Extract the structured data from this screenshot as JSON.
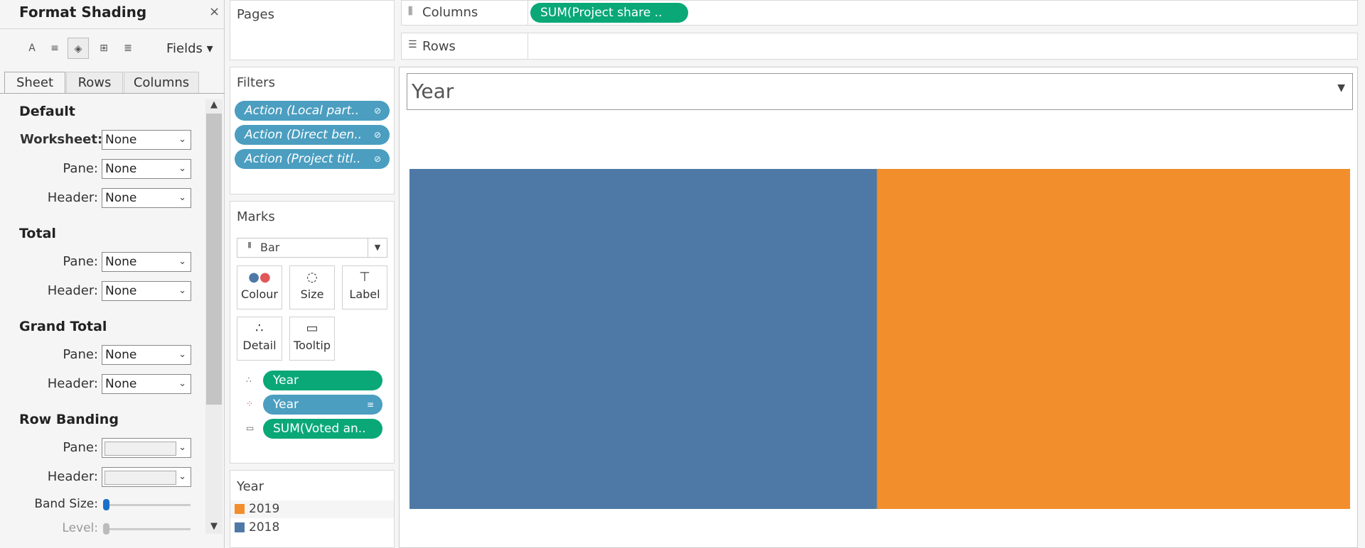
{
  "format_pane": {
    "title": "Format Shading",
    "close": "×",
    "toolbar": {
      "font": "A",
      "align": "≡",
      "shading": "◈",
      "borders": "⊞",
      "lines": "≣"
    },
    "fields_label": "Fields ▾",
    "tabs": [
      "Sheet",
      "Rows",
      "Columns"
    ],
    "sections": {
      "default": {
        "title": "Default",
        "worksheet_label": "Worksheet:",
        "worksheet_value": "None",
        "pane_label": "Pane:",
        "pane_value": "None",
        "header_label": "Header:",
        "header_value": "None"
      },
      "total": {
        "title": "Total",
        "pane_label": "Pane:",
        "pane_value": "None",
        "header_label": "Header:",
        "header_value": "None"
      },
      "grand_total": {
        "title": "Grand Total",
        "pane_label": "Pane:",
        "pane_value": "None",
        "header_label": "Header:",
        "header_value": "None"
      },
      "row_banding": {
        "title": "Row Banding",
        "pane_label": "Pane:",
        "header_label": "Header:",
        "band_size_label": "Band Size:",
        "band_size_value": 0,
        "level_label": "Level:",
        "level_value": 0
      }
    }
  },
  "pages": {
    "title": "Pages"
  },
  "filters": {
    "title": "Filters",
    "pills": [
      "Action (Local part..",
      "Action (Direct ben..",
      "Action (Project titl.."
    ]
  },
  "marks": {
    "title": "Marks",
    "type": "Bar",
    "buttons": {
      "colour": "Colour",
      "size": "Size",
      "label": "Label",
      "detail": "Detail",
      "tooltip": "Tooltip"
    },
    "fields": [
      "Year",
      "Year",
      "SUM(Voted an.."
    ]
  },
  "legend": {
    "title": "Year",
    "items": [
      {
        "label": "2019",
        "color": "#f28e2b"
      },
      {
        "label": "2018",
        "color": "#4e79a7"
      }
    ]
  },
  "shelves": {
    "columns_label": "Columns",
    "columns_pill": "SUM(Project share ..",
    "rows_label": "Rows"
  },
  "year_filter": {
    "label": "Year"
  },
  "chart_data": {
    "type": "bar",
    "orientation": "horizontal-stacked",
    "series": [
      {
        "name": "2018",
        "color": "#4e79a7",
        "share": 0.497
      },
      {
        "name": "2019",
        "color": "#f28e2b",
        "share": 0.503
      }
    ]
  }
}
